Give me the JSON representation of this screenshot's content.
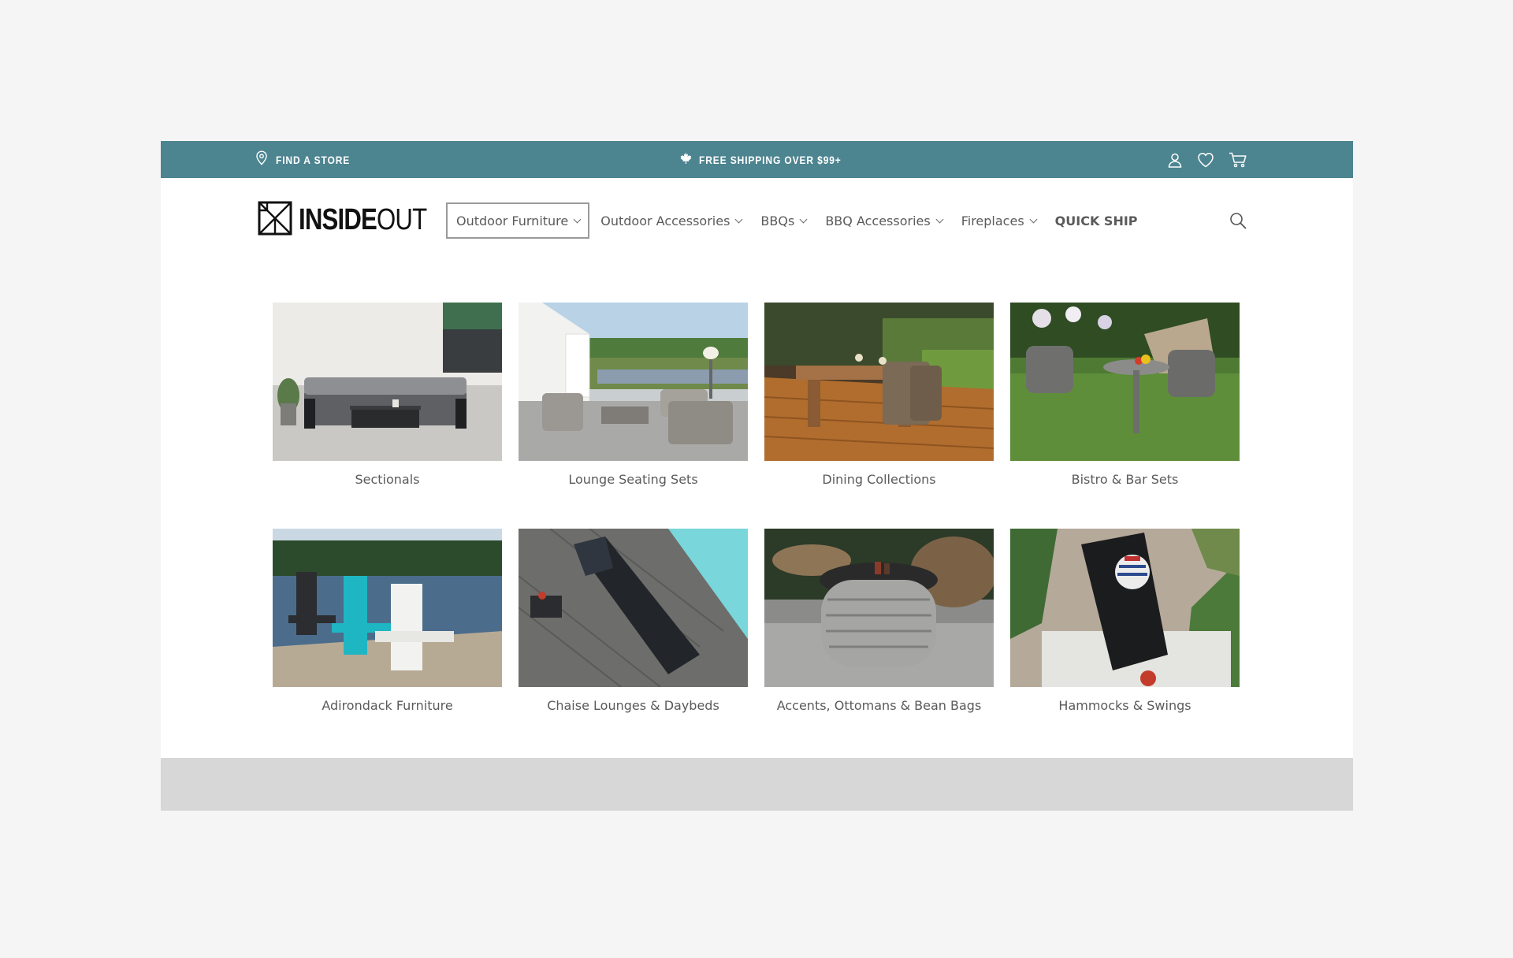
{
  "topbar": {
    "find_store": "FIND A STORE",
    "shipping": "FREE SHIPPING OVER $99+",
    "icons": [
      "location-pin-icon",
      "maple-leaf-icon",
      "account-icon",
      "heart-icon",
      "cart-icon"
    ],
    "background": "#4c8490"
  },
  "header": {
    "logo_bold": "INSIDE",
    "logo_light": "OUT",
    "nav": [
      {
        "label": "Outdoor Furniture",
        "active": true
      },
      {
        "label": "Outdoor Accessories"
      },
      {
        "label": "BBQs"
      },
      {
        "label": "BBQ Accessories"
      },
      {
        "label": "Fireplaces"
      },
      {
        "label": "QUICK SHIP"
      }
    ],
    "search_icon": "search-icon"
  },
  "categories": [
    {
      "label": "Sectionals"
    },
    {
      "label": "Lounge Seating Sets"
    },
    {
      "label": "Dining Collections"
    },
    {
      "label": "Bistro & Bar Sets"
    },
    {
      "label": "Adirondack Furniture"
    },
    {
      "label": "Chaise Lounges & Daybeds"
    },
    {
      "label": "Accents, Ottomans & Bean Bags"
    },
    {
      "label": "Hammocks & Swings"
    }
  ]
}
